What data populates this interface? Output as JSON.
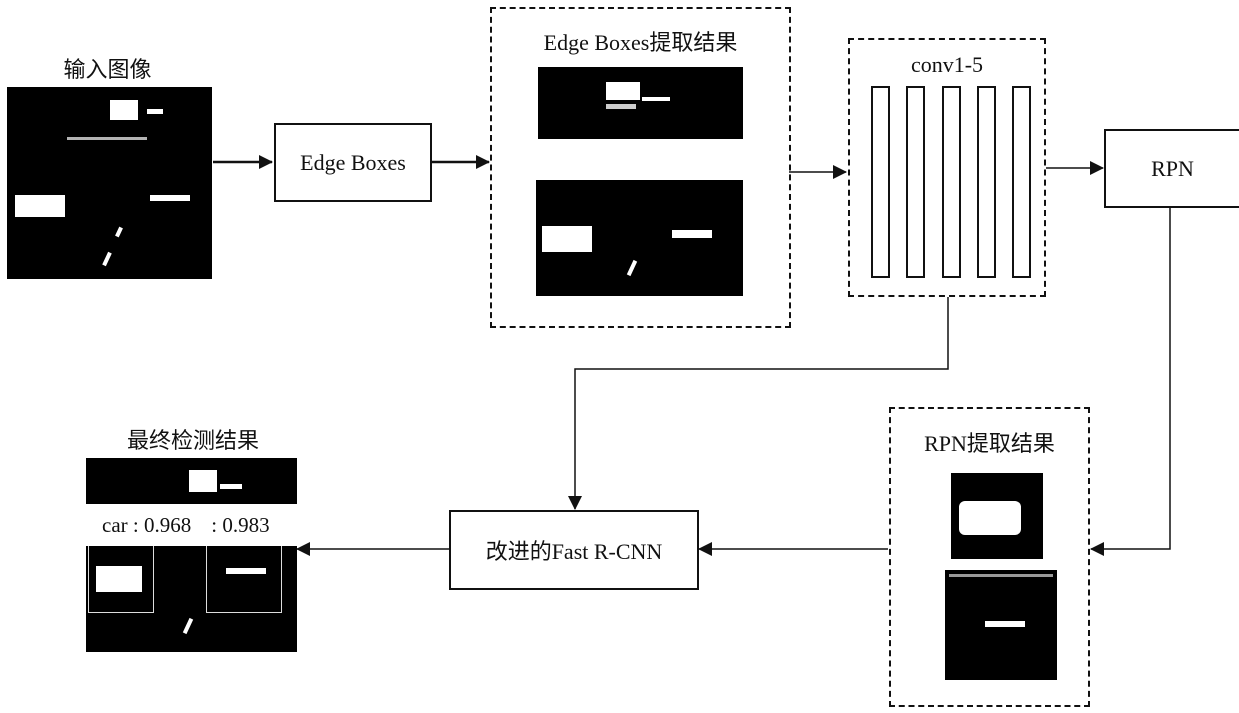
{
  "diagram": {
    "input": {
      "title": "输入图像"
    },
    "edge_boxes": {
      "label": "Edge Boxes"
    },
    "edge_results": {
      "title": "Edge Boxes提取结果"
    },
    "conv": {
      "title": "conv1-5",
      "layer_count": 5
    },
    "rpn": {
      "label": "RPN"
    },
    "rpn_results": {
      "title": "RPN提取结果"
    },
    "fast_rcnn": {
      "label": "改进的Fast R-CNN"
    },
    "final": {
      "title": "最终检测结果",
      "score_left": "car : 0.968",
      "score_right": ": 0.983"
    }
  },
  "edges": [
    {
      "from": "input-image",
      "to": "edge-boxes"
    },
    {
      "from": "edge-boxes",
      "to": "edge-boxes-results"
    },
    {
      "from": "edge-boxes-results",
      "to": "conv1-5"
    },
    {
      "from": "conv1-5",
      "to": "rpn"
    },
    {
      "from": "rpn",
      "to": "rpn-results"
    },
    {
      "from": "conv1-5",
      "to": "fast-rcnn"
    },
    {
      "from": "rpn-results",
      "to": "fast-rcnn"
    },
    {
      "from": "fast-rcnn",
      "to": "final-result"
    }
  ]
}
